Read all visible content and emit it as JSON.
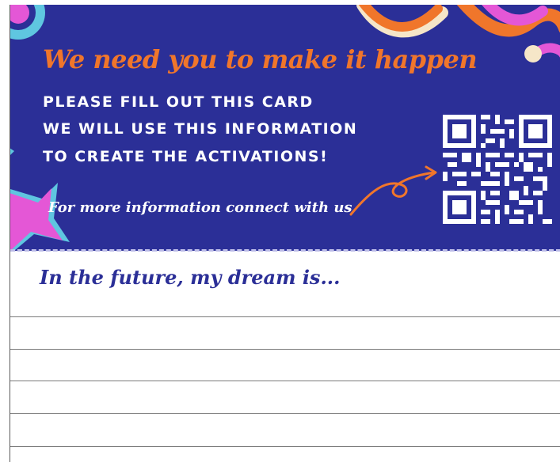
{
  "card": {
    "headline": "We need you to make it happen",
    "instructions": [
      "PLEASE FILL OUT THIS CARD",
      "WE WILL USE THIS INFORMATION",
      "TO CREATE THE ACTIVATIONS!"
    ],
    "connect_text": "For more information connect with us",
    "prompt": "In the future, my dream is...",
    "writing_lines": 5
  },
  "colors": {
    "banner_bg": "#2b2f97",
    "headline": "#f0762b",
    "prompt": "#2b2f97",
    "accent_pink": "#e457d6",
    "accent_cyan": "#5fc6e0",
    "accent_orange": "#f0762b"
  },
  "icons": [
    "qr-code-icon",
    "curly-arrow-icon"
  ]
}
